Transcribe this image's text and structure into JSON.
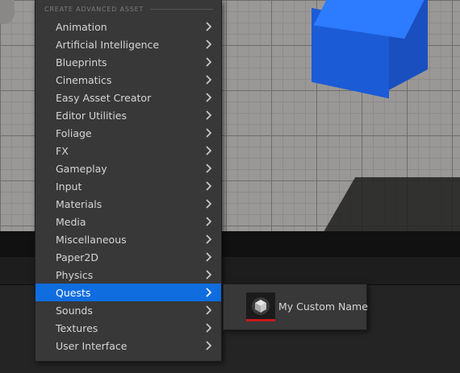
{
  "menu": {
    "header": "CREATE ADVANCED ASSET",
    "items": [
      {
        "label": "Animation"
      },
      {
        "label": "Artificial Intelligence"
      },
      {
        "label": "Blueprints"
      },
      {
        "label": "Cinematics"
      },
      {
        "label": "Easy Asset Creator"
      },
      {
        "label": "Editor Utilities"
      },
      {
        "label": "Foliage"
      },
      {
        "label": "FX"
      },
      {
        "label": "Gameplay"
      },
      {
        "label": "Input"
      },
      {
        "label": "Materials"
      },
      {
        "label": "Media"
      },
      {
        "label": "Miscellaneous"
      },
      {
        "label": "Paper2D"
      },
      {
        "label": "Physics"
      },
      {
        "label": "Quests"
      },
      {
        "label": "Sounds"
      },
      {
        "label": "Textures"
      },
      {
        "label": "User Interface"
      }
    ],
    "active_item": "Quests",
    "chevron_icon": "chevron-right-icon"
  },
  "submenu": {
    "items": [
      {
        "label": "My Custom Name",
        "icon": "asset-cube-icon"
      }
    ]
  },
  "colors": {
    "active_highlight": "#0f6de0",
    "asset_type_underline": "#c8191d",
    "menu_background": "#383838",
    "text": "#d6d6d6"
  }
}
